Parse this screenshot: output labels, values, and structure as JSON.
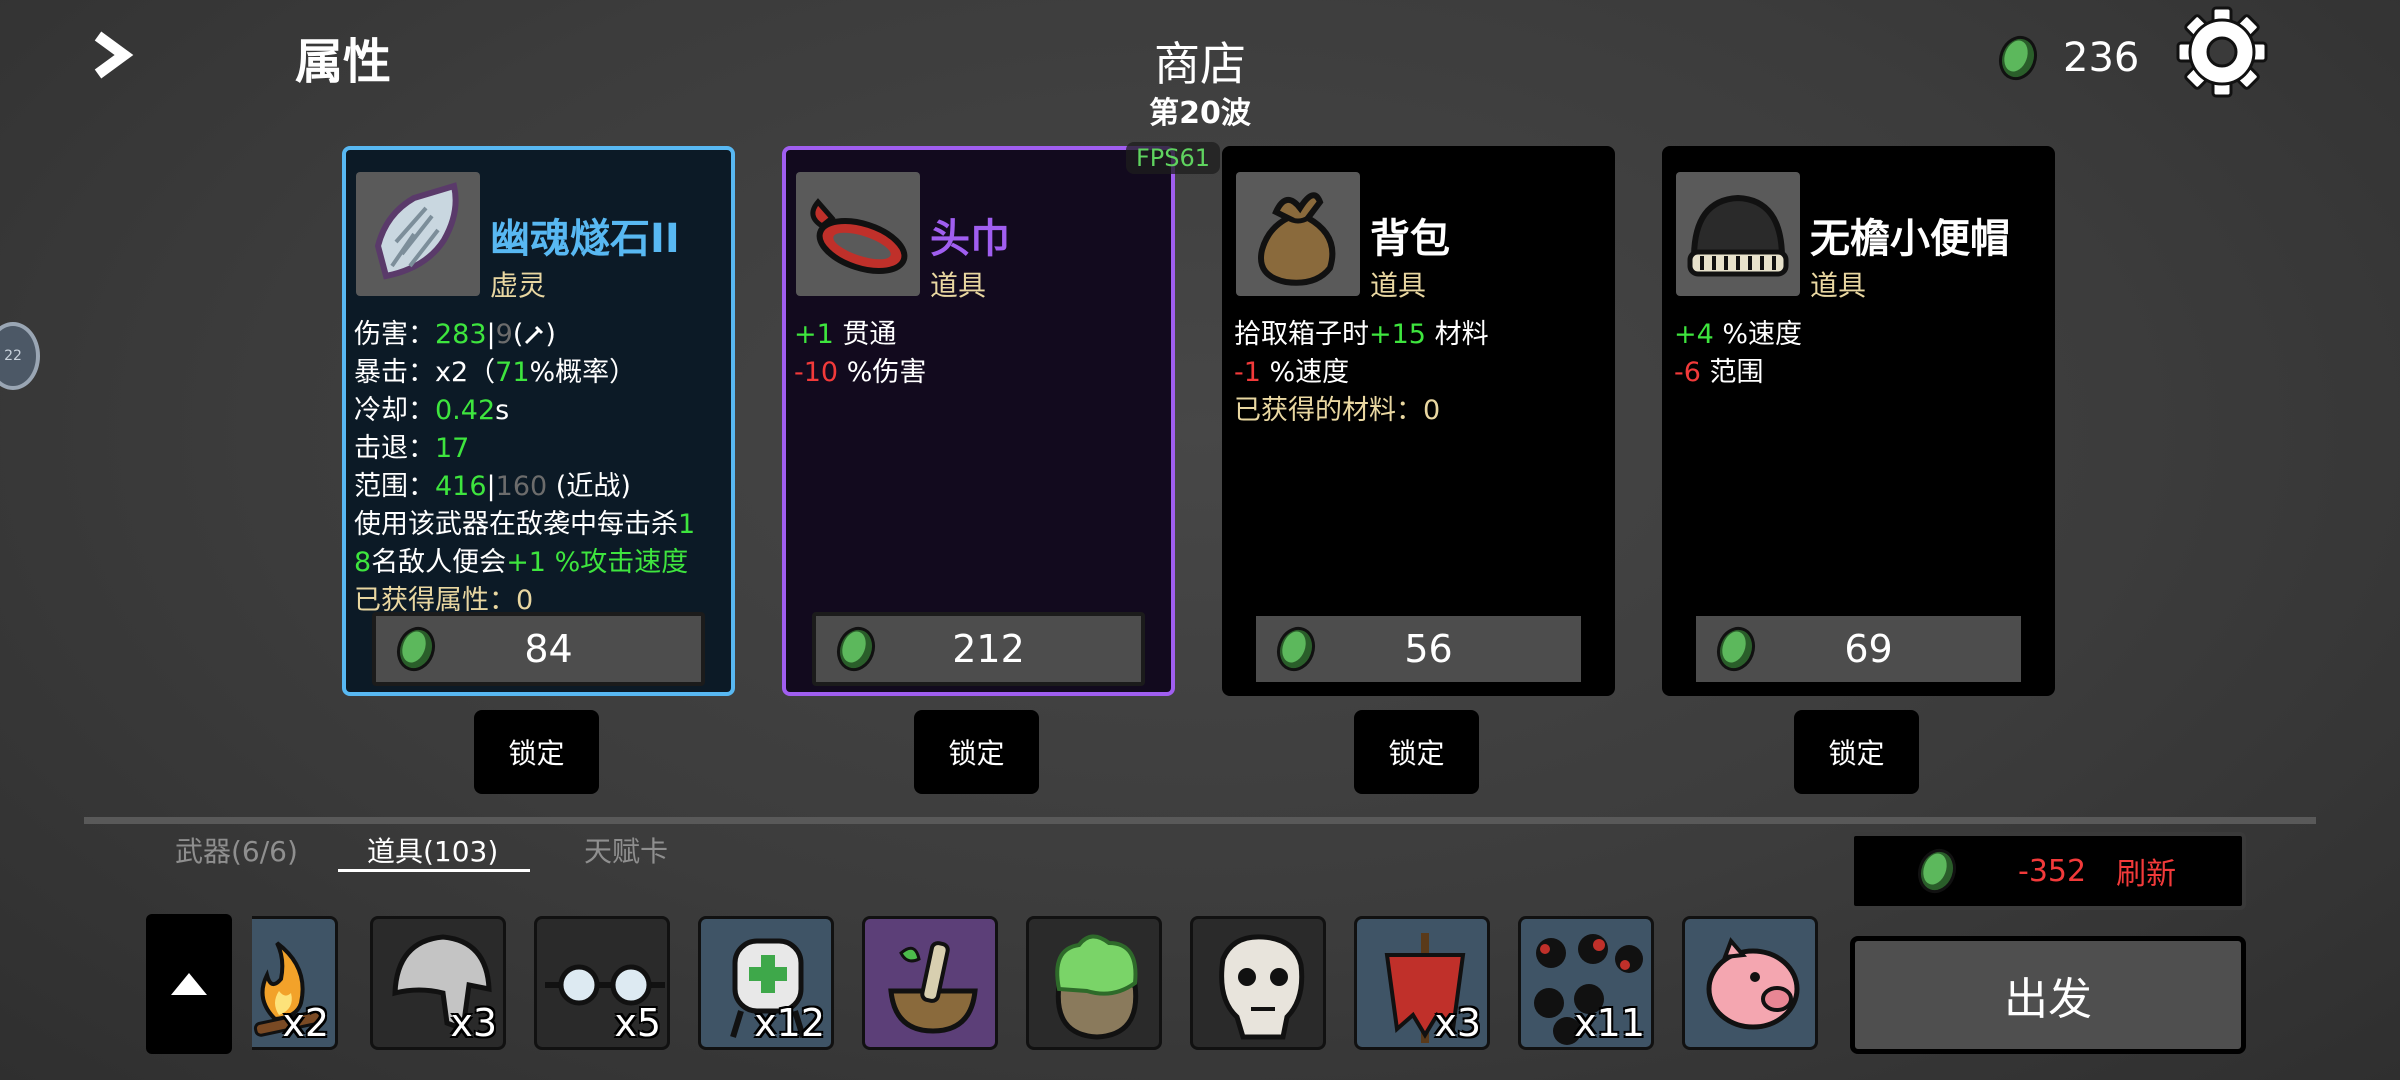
{
  "header": {
    "attributes_label": "属性",
    "shop_title": "商店",
    "wave_label": "第20波",
    "materials_count": "236",
    "fps_label": "FPS61"
  },
  "cards": [
    {
      "name": "幽魂燧石II",
      "type": "虚灵",
      "name_color": "#58b8f2",
      "price": "84",
      "lock_label": "锁定",
      "stats": {
        "damage_label": "伤害：",
        "damage_value": "283",
        "damage_sep": "|",
        "damage_base": "9",
        "damage_scale_open": "(",
        "damage_scale_close": ")",
        "crit_label": "暴击：",
        "crit_mult": "x2（",
        "crit_chance": "71",
        "crit_suffix": "%概率）",
        "cooldown_label": "冷却：",
        "cooldown_value": "0.42",
        "cooldown_unit": "s",
        "knockback_label": "击退：",
        "knockback_value": "17",
        "range_label": "范围：",
        "range_value": "416",
        "range_sep": "|",
        "range_base": "160",
        "range_suffix": " (近战)",
        "effect_part1": "使用该武器在敌袭中每击杀",
        "effect_num_a": "1",
        "effect_num_b": "8",
        "effect_part2": "名敌人便会",
        "effect_bonus": "+1 %攻击速度",
        "gained_label": "已获得属性：",
        "gained_value": "0"
      }
    },
    {
      "name": "头巾",
      "type": "道具",
      "name_color": "#a05ef0",
      "price": "212",
      "lock_label": "锁定",
      "stats": {
        "s1_value": "+1",
        "s1_text": " 贯通",
        "s2_value": "-10",
        "s2_text": " %伤害"
      }
    },
    {
      "name": "背包",
      "type": "道具",
      "name_color": "#ffffff",
      "price": "56",
      "lock_label": "锁定",
      "stats": {
        "s1_text_a": "拾取箱子时",
        "s1_value": "+15",
        "s1_text_b": " 材料",
        "s2_value": "-1",
        "s2_text": " %速度",
        "s3_text": "已获得的材料：",
        "s3_value": "0"
      }
    },
    {
      "name": "无檐小便帽",
      "type": "道具",
      "name_color": "#ffffff",
      "price": "69",
      "lock_label": "锁定",
      "stats": {
        "s1_value": "+4",
        "s1_text": " %速度",
        "s2_value": "-6",
        "s2_text": " 范围"
      }
    }
  ],
  "tabs": [
    {
      "label": "武器(6/6)",
      "active": false
    },
    {
      "label": "道具(103)",
      "active": true
    },
    {
      "label": "天赋卡",
      "active": false
    }
  ],
  "inventory": [
    {
      "icon": "campfire-icon",
      "count": "x2"
    },
    {
      "icon": "helmet-icon",
      "count": "x3"
    },
    {
      "icon": "goggles-icon",
      "count": "x5"
    },
    {
      "icon": "medic-backpack-icon",
      "count": "x12"
    },
    {
      "icon": "mortar-pestle-icon",
      "count": ""
    },
    {
      "icon": "herb-sack-icon",
      "count": ""
    },
    {
      "icon": "skull-face-icon",
      "count": ""
    },
    {
      "icon": "scarecrow-icon",
      "count": "x3"
    },
    {
      "icon": "bloody-orbs-icon",
      "count": "x11"
    },
    {
      "icon": "piggy-bank-icon",
      "count": ""
    }
  ],
  "refresh": {
    "cost": "-352",
    "label": "刷新"
  },
  "go_button": {
    "label": "出发"
  },
  "colors": {
    "positive": "#3ee53e",
    "negative": "#f23a3a",
    "material_green": "#5cb85c",
    "weapon_border": "#58b8f2",
    "rare_border": "#a05ef0"
  }
}
